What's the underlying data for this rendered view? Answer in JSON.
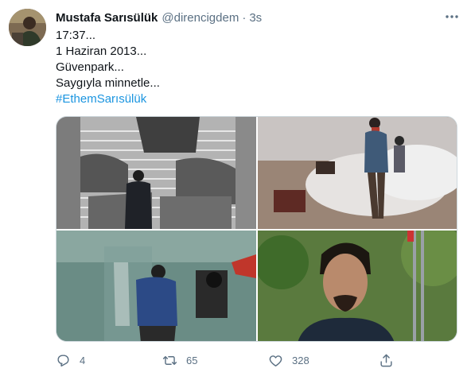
{
  "tweet": {
    "author_name": "Mustafa Sarısülük",
    "handle": "@direncigdem",
    "separator": "·",
    "time": "3s",
    "lines": [
      "17:37...",
      "1 Haziran 2013...",
      "Güvenpark...",
      "Saygıyla minnetle..."
    ],
    "hashtag": "#EthemSarısülük"
  },
  "media": {
    "images": [
      "protest-stairs-photo",
      "street-clash-photo",
      "shield-photo",
      "portrait-photo"
    ]
  },
  "actions": {
    "reply": {
      "icon": "reply-icon",
      "count": "4"
    },
    "retweet": {
      "icon": "retweet-icon",
      "count": "65"
    },
    "like": {
      "icon": "heart-icon",
      "count": "328"
    },
    "share": {
      "icon": "share-icon",
      "count": ""
    }
  },
  "colors": {
    "link": "#1b95e0",
    "muted": "#5b7083",
    "text": "#0f1419",
    "border": "#cfd9de"
  }
}
